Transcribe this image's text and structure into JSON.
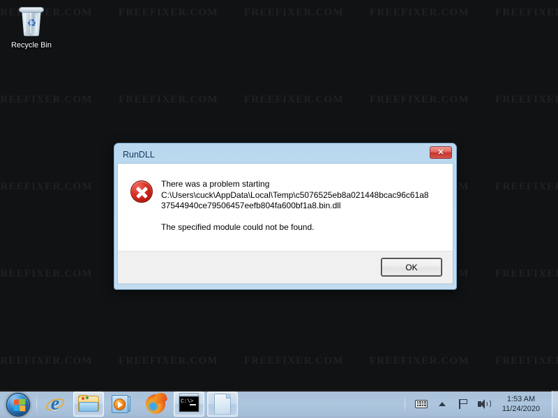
{
  "desktop": {
    "watermark_text": "FREEFIXER.COM",
    "background_color": "#111214",
    "icons": [
      {
        "name": "recycle-bin",
        "label": "Recycle Bin"
      }
    ]
  },
  "dialog": {
    "title": "RunDLL",
    "close_label": "✕",
    "message_line1": "There was a problem starting",
    "message_line2": "C:\\Users\\cuck\\AppData\\Local\\Temp\\c5076525eb8a021448bcac96c61a8",
    "message_line3": "37544940ce79506457eefb804fa600bf1a8.bin.dll",
    "message_line4": "The specified module could not be found.",
    "ok_label": "OK",
    "icon": "error-icon",
    "accent_color": "#b9d7ee",
    "error_color": "#d92c20"
  },
  "taskbar": {
    "start": {
      "name": "start-orb",
      "label": "Start"
    },
    "buttons": [
      {
        "name": "internet-explorer-icon",
        "label": "Internet Explorer",
        "state": "pinned"
      },
      {
        "name": "file-explorer-icon",
        "label": "Windows Explorer",
        "state": "running"
      },
      {
        "name": "media-player-icon",
        "label": "Windows Media Player",
        "state": "pinned"
      },
      {
        "name": "firefox-icon",
        "label": "Mozilla Firefox",
        "state": "pinned"
      },
      {
        "name": "command-prompt-icon",
        "label": "Command Prompt",
        "state": "running"
      },
      {
        "name": "document-window-icon",
        "label": "Document",
        "state": "running"
      }
    ],
    "tray": {
      "icons": [
        {
          "name": "keyboard-icon",
          "label": "Keyboard layout"
        },
        {
          "name": "show-hidden-icons-icon",
          "label": "Show hidden icons"
        },
        {
          "name": "action-center-flag-icon",
          "label": "Action Center"
        },
        {
          "name": "volume-speaker-icon",
          "label": "Volume"
        }
      ],
      "clock_time": "1:53 AM",
      "clock_date": "11/24/2020"
    }
  }
}
